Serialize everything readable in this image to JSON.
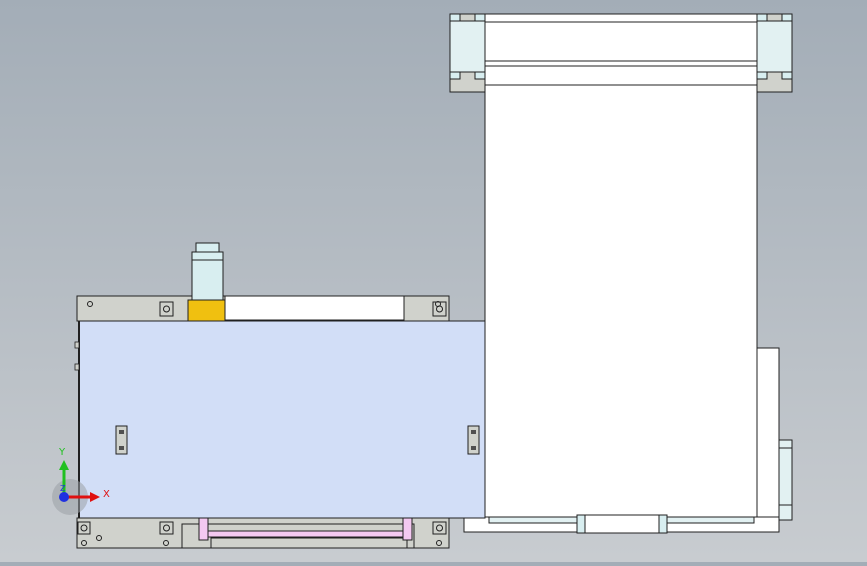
{
  "viewport": {
    "background_top": "#a3adb7",
    "background_bottom": "#c8ccd0"
  },
  "model": {
    "face_blue": "#d2def7",
    "face_white": "#ffffff",
    "face_grey": "#d0d2cc",
    "face_teal": "#d8eef0",
    "motor_yellow": "#f0c010",
    "rod_pink": "#f4c9f1",
    "edge_dark": "#202020"
  },
  "triad": {
    "x_label": "X",
    "y_label": "Y",
    "z_label": "Z",
    "x_color": "#e01010",
    "y_color": "#20c020",
    "z_color": "#2030e0"
  }
}
